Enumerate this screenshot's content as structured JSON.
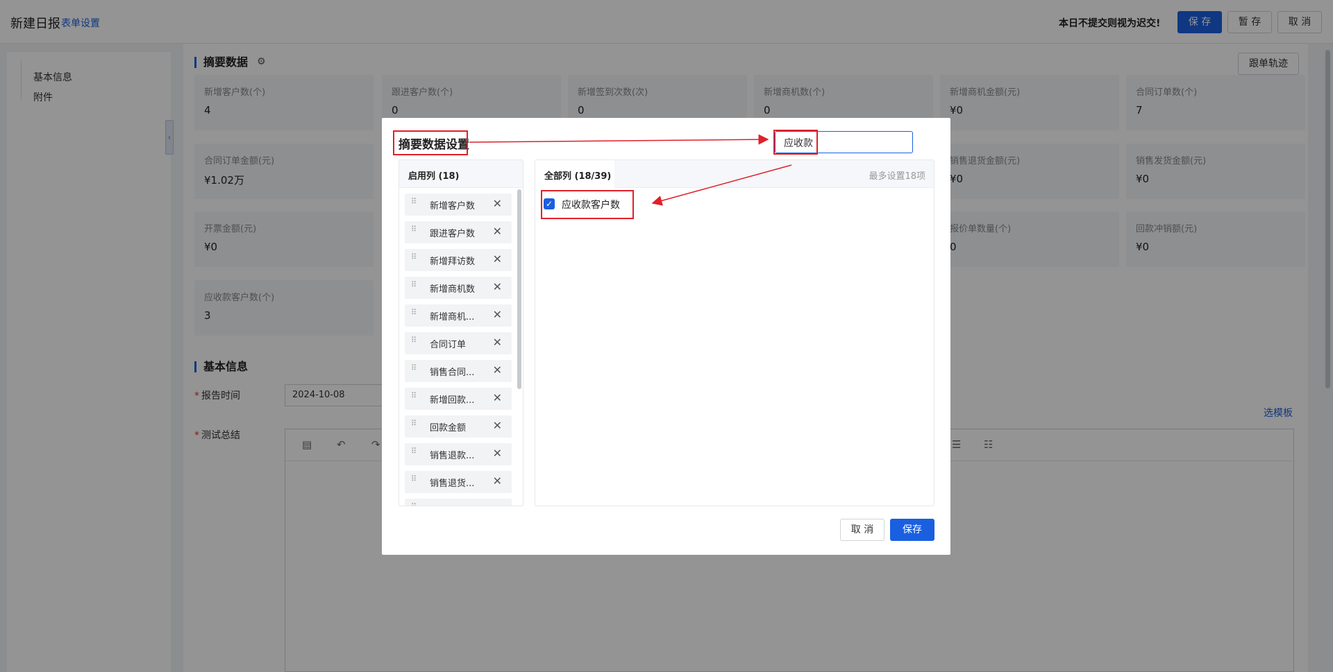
{
  "header": {
    "title": "新建日报",
    "form_settings_link": "表单设置",
    "warning": "本日不提交则视为迟交!",
    "save_label": "保 存",
    "draft_label": "暂 存",
    "cancel_label": "取 消"
  },
  "sidebar": {
    "items": [
      {
        "label": "基本信息"
      },
      {
        "label": "附件"
      }
    ]
  },
  "summary": {
    "title": "摘要数据",
    "track_button": "跟单轨迹",
    "cards": [
      {
        "label": "新增客户数(个)",
        "value": "4"
      },
      {
        "label": "跟进客户数(个)",
        "value": "0"
      },
      {
        "label": "新增签到次数(次)",
        "value": "0"
      },
      {
        "label": "新增商机数(个)",
        "value": "0"
      },
      {
        "label": "新增商机金额(元)",
        "value": "¥0"
      },
      {
        "label": "合同订单数(个)",
        "value": "7"
      },
      {
        "label": "合同订单金额(元)",
        "value": "¥1.02万"
      },
      {
        "label": "销售退货金额(元)",
        "value": "¥0"
      },
      {
        "label": "销售发货金额(元)",
        "value": "¥0"
      },
      {
        "label": "开票金额(元)",
        "value": "¥0"
      },
      {
        "label": "报价单数量(个)",
        "value": "0"
      },
      {
        "label": "回款冲销额(元)",
        "value": "¥0"
      },
      {
        "label": "应收款客户数(个)",
        "value": "3"
      }
    ]
  },
  "basic_info": {
    "title": "基本信息",
    "report_time_label": "报告时间",
    "report_time_value": "2024-10-08",
    "summary_label": "测试总结",
    "template_link": "选模板"
  },
  "modal": {
    "title": "摘要数据设置",
    "search_value": "应收款",
    "enabled_header": "启用列 (18)",
    "enabled_items": [
      {
        "label": "新增客户数"
      },
      {
        "label": "跟进客户数"
      },
      {
        "label": "新增拜访数"
      },
      {
        "label": "新增商机数"
      },
      {
        "label": "新增商机..."
      },
      {
        "label": "合同订单"
      },
      {
        "label": "销售合同..."
      },
      {
        "label": "新增回款..."
      },
      {
        "label": "回款金额"
      },
      {
        "label": "销售退款..."
      },
      {
        "label": "销售退货..."
      }
    ],
    "all_header": "全部列 (18/39)",
    "max_note": "最多设置18项",
    "results": [
      {
        "label": "应收款客户数",
        "checked": true
      }
    ],
    "cancel_label": "取 消",
    "save_label": "保存"
  },
  "colors": {
    "primary": "#1a5fe0",
    "annotation_red": "#e0202a"
  }
}
